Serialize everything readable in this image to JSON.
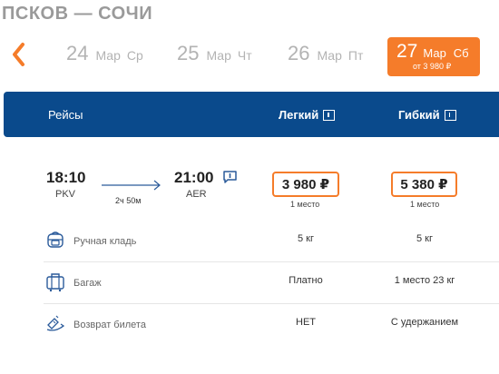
{
  "route": {
    "title": "ПСКОВ — СОЧИ"
  },
  "dates": [
    {
      "day": "24",
      "month": "Мар",
      "weekday": "Ср"
    },
    {
      "day": "25",
      "month": "Мар",
      "weekday": "Чт"
    },
    {
      "day": "26",
      "month": "Мар",
      "weekday": "Пт"
    }
  ],
  "active_date": {
    "day": "27",
    "month": "Мар",
    "weekday": "Сб",
    "price": "от 3 980 ₽"
  },
  "header": {
    "flights_label": "Рейсы",
    "tariff_light": "Легкий",
    "tariff_flex": "Гибкий"
  },
  "flight": {
    "departure_time": "18:10",
    "departure_code": "PKV",
    "arrival_time": "21:00",
    "arrival_code": "AER",
    "duration": "2ч 50м",
    "light_price": "3 980 ₽",
    "light_seats": "1 место",
    "flex_price": "5 380 ₽",
    "flex_seats": "1 место"
  },
  "features": [
    {
      "icon": "carry-on-bag-icon",
      "label": "Ручная кладь",
      "light": "5 кг",
      "flex": "5 кг"
    },
    {
      "icon": "luggage-icon",
      "label": "Багаж",
      "light": "Платно",
      "flex": "1 место 23 кг"
    },
    {
      "icon": "ticket-return-icon",
      "label": "Возврат билета",
      "light": "НЕТ",
      "flex": "С удержанием"
    }
  ],
  "colors": {
    "accent": "#f57c2a",
    "header_bg": "#0a4a8c",
    "icon": "#2a5a9a"
  }
}
